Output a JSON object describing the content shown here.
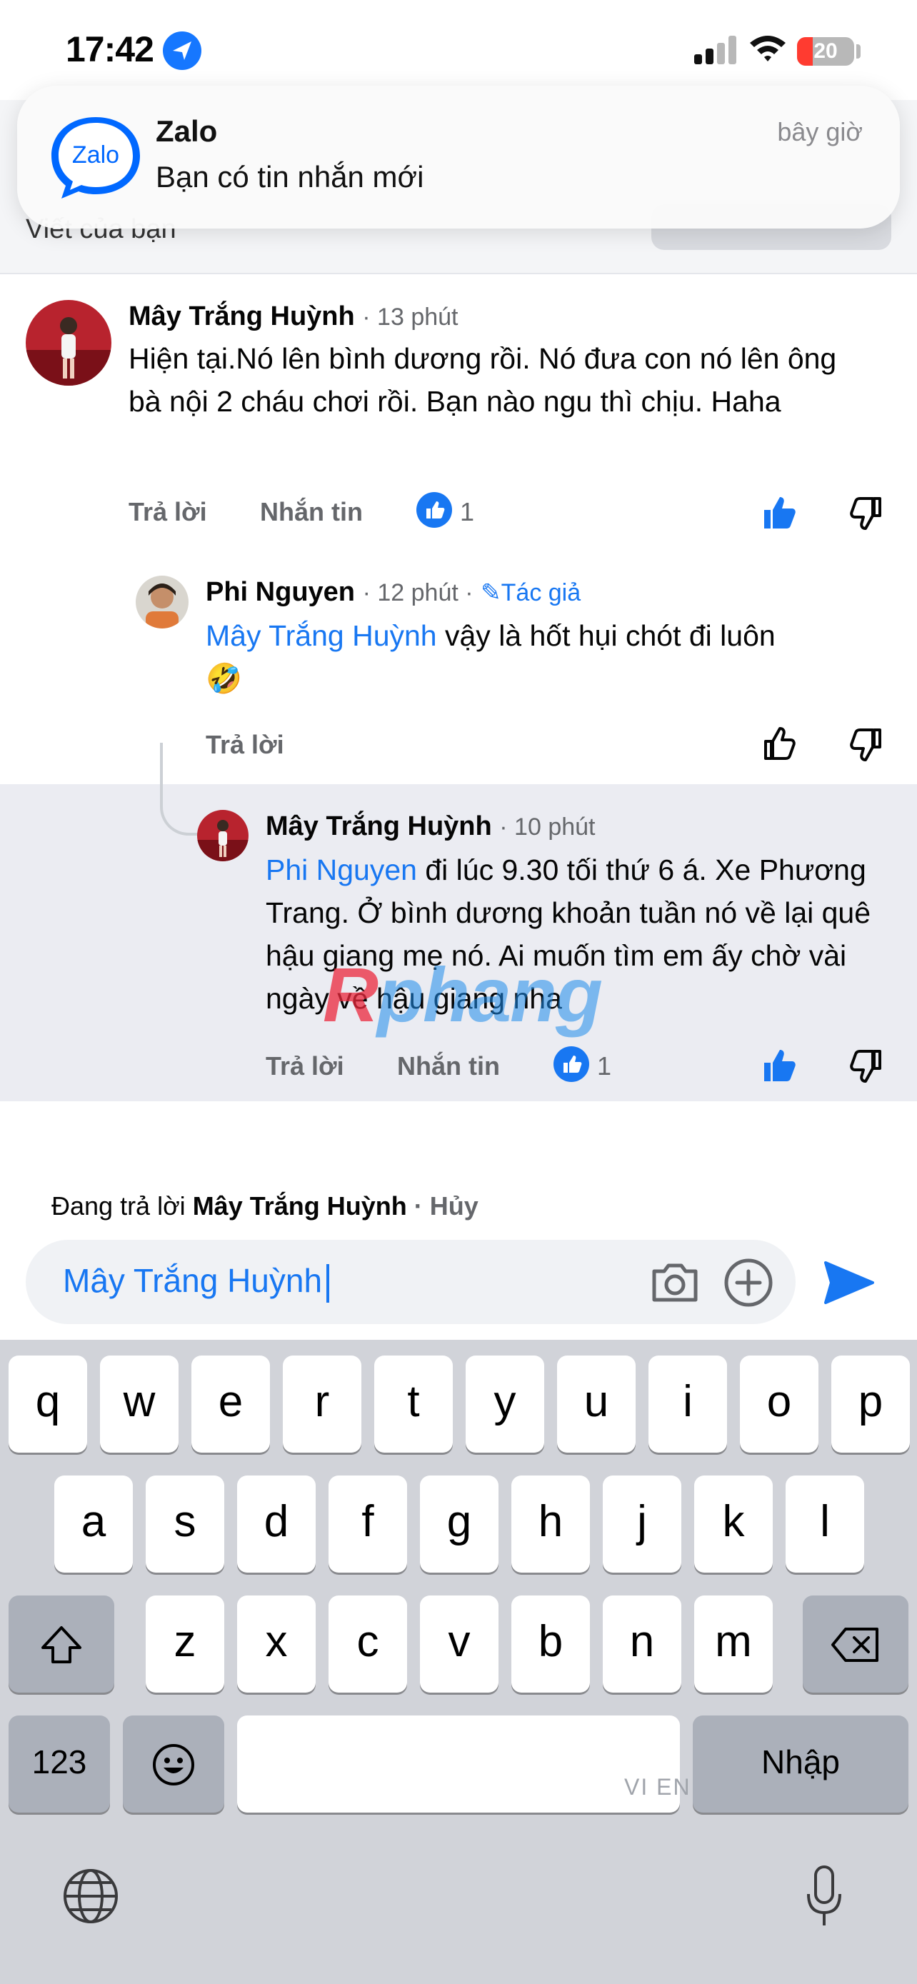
{
  "status_bar": {
    "time": "17:42",
    "battery": "20",
    "location_icon": "location-arrow-icon",
    "signal_icon": "cellular-signal-icon",
    "wifi_icon": "wifi-icon"
  },
  "background_header": {
    "text": "Viết của bạn"
  },
  "notification": {
    "app_logo_text": "Zalo",
    "title": "Zalo",
    "body": "Bạn có tin nhắn mới",
    "time": "bây giờ",
    "brand_color": "#0068ff"
  },
  "comments": [
    {
      "author": "Mây Trắng Huỳnh",
      "time": "· 13 phút",
      "body": "Hiện tại.Nó lên bình dương rồi. Nó đưa con nó lên ông bà nội 2 cháu chơi rồi. Bạn nào ngu thì chịu. Haha",
      "reply_label": "Trả lời",
      "message_label": "Nhắn tin",
      "like_count": "1",
      "liked": true
    },
    {
      "author": "Phi Nguyen",
      "time": "· 12 phút ·",
      "author_badge": "Tác giả",
      "mention": "Mây Trắng Huỳnh",
      "body": " vậy là hốt hụi chót đi luôn",
      "emoji": "🤣",
      "reply_label": "Trả lời",
      "liked": false
    },
    {
      "author": "Mây Trắng Huỳnh",
      "time": "· 10 phút",
      "mention": "Phi Nguyen",
      "body": " đi lúc 9.30 tối thứ 6 á. Xe Phương Trang. Ở bình dương khoản tuần nó về lại quê hậu giang mẹ nó. Ai muốn tìm em ấy chờ vài ngày về hậu giang nha",
      "reply_label": "Trả lời",
      "message_label": "Nhắn tin",
      "like_count": "1",
      "liked": true
    }
  ],
  "watermark": {
    "first": "R",
    "rest": "phang"
  },
  "reply_bar": {
    "replying_prefix": "Đang trả lời ",
    "replying_to": "Mây Trắng Huỳnh",
    "cancel": "· Hủy",
    "input_value": "Mây Trắng Huỳnh"
  },
  "keyboard": {
    "row1": [
      "q",
      "w",
      "e",
      "r",
      "t",
      "y",
      "u",
      "i",
      "o",
      "p"
    ],
    "row2": [
      "a",
      "s",
      "d",
      "f",
      "g",
      "h",
      "j",
      "k",
      "l"
    ],
    "row3": [
      "z",
      "x",
      "c",
      "v",
      "b",
      "n",
      "m"
    ],
    "numbers_key": "123",
    "return_key": "Nhập",
    "space_hint": "VI EN"
  },
  "colors": {
    "accent": "#1877f2",
    "secondary_text": "#65676b",
    "highlight_bg": "#ebecf2"
  }
}
